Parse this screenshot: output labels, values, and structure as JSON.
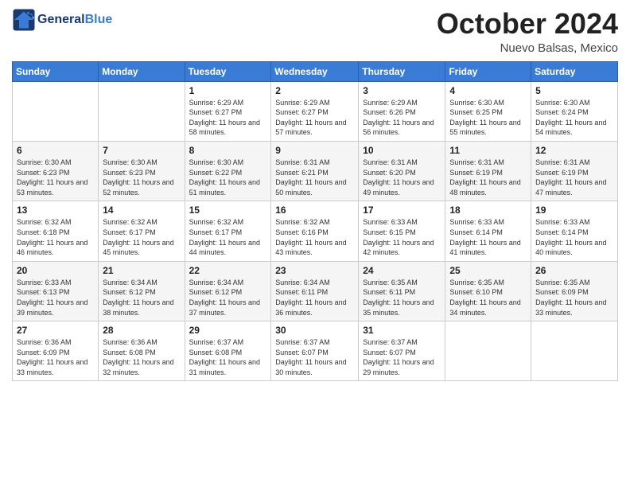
{
  "header": {
    "logo_general": "General",
    "logo_blue": "Blue",
    "month": "October 2024",
    "location": "Nuevo Balsas, Mexico"
  },
  "days_of_week": [
    "Sunday",
    "Monday",
    "Tuesday",
    "Wednesday",
    "Thursday",
    "Friday",
    "Saturday"
  ],
  "weeks": [
    [
      {
        "day": "",
        "info": ""
      },
      {
        "day": "",
        "info": ""
      },
      {
        "day": "1",
        "info": "Sunrise: 6:29 AM\nSunset: 6:27 PM\nDaylight: 11 hours and 58 minutes."
      },
      {
        "day": "2",
        "info": "Sunrise: 6:29 AM\nSunset: 6:27 PM\nDaylight: 11 hours and 57 minutes."
      },
      {
        "day": "3",
        "info": "Sunrise: 6:29 AM\nSunset: 6:26 PM\nDaylight: 11 hours and 56 minutes."
      },
      {
        "day": "4",
        "info": "Sunrise: 6:30 AM\nSunset: 6:25 PM\nDaylight: 11 hours and 55 minutes."
      },
      {
        "day": "5",
        "info": "Sunrise: 6:30 AM\nSunset: 6:24 PM\nDaylight: 11 hours and 54 minutes."
      }
    ],
    [
      {
        "day": "6",
        "info": "Sunrise: 6:30 AM\nSunset: 6:23 PM\nDaylight: 11 hours and 53 minutes."
      },
      {
        "day": "7",
        "info": "Sunrise: 6:30 AM\nSunset: 6:23 PM\nDaylight: 11 hours and 52 minutes."
      },
      {
        "day": "8",
        "info": "Sunrise: 6:30 AM\nSunset: 6:22 PM\nDaylight: 11 hours and 51 minutes."
      },
      {
        "day": "9",
        "info": "Sunrise: 6:31 AM\nSunset: 6:21 PM\nDaylight: 11 hours and 50 minutes."
      },
      {
        "day": "10",
        "info": "Sunrise: 6:31 AM\nSunset: 6:20 PM\nDaylight: 11 hours and 49 minutes."
      },
      {
        "day": "11",
        "info": "Sunrise: 6:31 AM\nSunset: 6:19 PM\nDaylight: 11 hours and 48 minutes."
      },
      {
        "day": "12",
        "info": "Sunrise: 6:31 AM\nSunset: 6:19 PM\nDaylight: 11 hours and 47 minutes."
      }
    ],
    [
      {
        "day": "13",
        "info": "Sunrise: 6:32 AM\nSunset: 6:18 PM\nDaylight: 11 hours and 46 minutes."
      },
      {
        "day": "14",
        "info": "Sunrise: 6:32 AM\nSunset: 6:17 PM\nDaylight: 11 hours and 45 minutes."
      },
      {
        "day": "15",
        "info": "Sunrise: 6:32 AM\nSunset: 6:17 PM\nDaylight: 11 hours and 44 minutes."
      },
      {
        "day": "16",
        "info": "Sunrise: 6:32 AM\nSunset: 6:16 PM\nDaylight: 11 hours and 43 minutes."
      },
      {
        "day": "17",
        "info": "Sunrise: 6:33 AM\nSunset: 6:15 PM\nDaylight: 11 hours and 42 minutes."
      },
      {
        "day": "18",
        "info": "Sunrise: 6:33 AM\nSunset: 6:14 PM\nDaylight: 11 hours and 41 minutes."
      },
      {
        "day": "19",
        "info": "Sunrise: 6:33 AM\nSunset: 6:14 PM\nDaylight: 11 hours and 40 minutes."
      }
    ],
    [
      {
        "day": "20",
        "info": "Sunrise: 6:33 AM\nSunset: 6:13 PM\nDaylight: 11 hours and 39 minutes."
      },
      {
        "day": "21",
        "info": "Sunrise: 6:34 AM\nSunset: 6:12 PM\nDaylight: 11 hours and 38 minutes."
      },
      {
        "day": "22",
        "info": "Sunrise: 6:34 AM\nSunset: 6:12 PM\nDaylight: 11 hours and 37 minutes."
      },
      {
        "day": "23",
        "info": "Sunrise: 6:34 AM\nSunset: 6:11 PM\nDaylight: 11 hours and 36 minutes."
      },
      {
        "day": "24",
        "info": "Sunrise: 6:35 AM\nSunset: 6:11 PM\nDaylight: 11 hours and 35 minutes."
      },
      {
        "day": "25",
        "info": "Sunrise: 6:35 AM\nSunset: 6:10 PM\nDaylight: 11 hours and 34 minutes."
      },
      {
        "day": "26",
        "info": "Sunrise: 6:35 AM\nSunset: 6:09 PM\nDaylight: 11 hours and 33 minutes."
      }
    ],
    [
      {
        "day": "27",
        "info": "Sunrise: 6:36 AM\nSunset: 6:09 PM\nDaylight: 11 hours and 33 minutes."
      },
      {
        "day": "28",
        "info": "Sunrise: 6:36 AM\nSunset: 6:08 PM\nDaylight: 11 hours and 32 minutes."
      },
      {
        "day": "29",
        "info": "Sunrise: 6:37 AM\nSunset: 6:08 PM\nDaylight: 11 hours and 31 minutes."
      },
      {
        "day": "30",
        "info": "Sunrise: 6:37 AM\nSunset: 6:07 PM\nDaylight: 11 hours and 30 minutes."
      },
      {
        "day": "31",
        "info": "Sunrise: 6:37 AM\nSunset: 6:07 PM\nDaylight: 11 hours and 29 minutes."
      },
      {
        "day": "",
        "info": ""
      },
      {
        "day": "",
        "info": ""
      }
    ]
  ]
}
